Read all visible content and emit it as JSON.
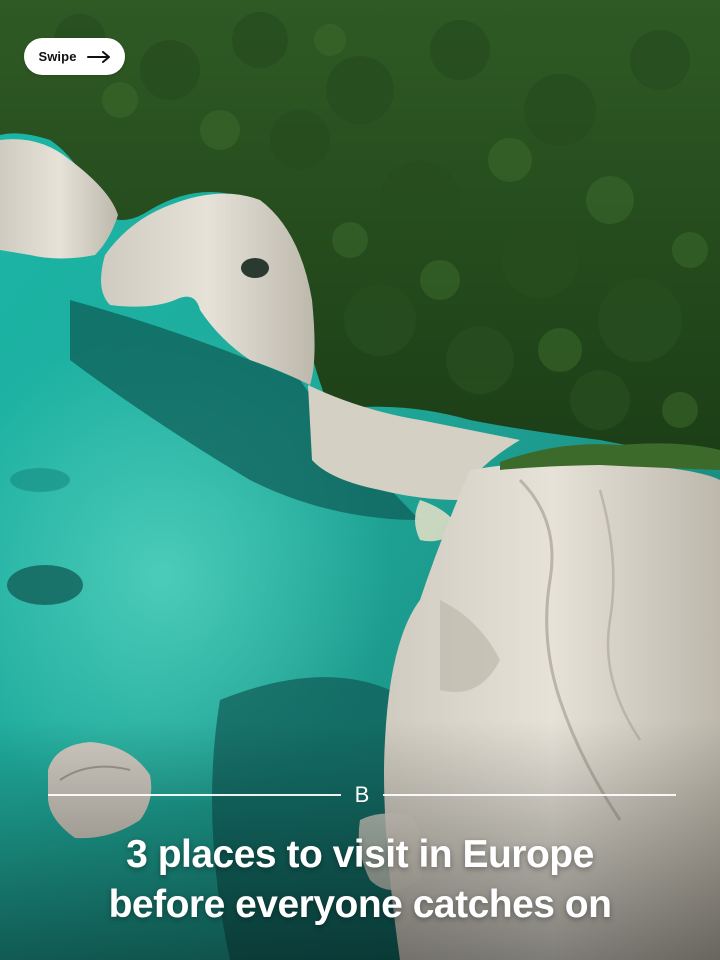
{
  "swipe": {
    "label": "Swipe",
    "icon": "arrow-right-icon"
  },
  "brand": {
    "mark": "B"
  },
  "headline": {
    "line1": "3 places to visit in Europe",
    "line2": "before everyone catches on"
  },
  "colors": {
    "forest": "#1f4a1e",
    "sea_turquoise": "#1fb3a2",
    "cliff": "#d9d6cc",
    "text": "#ffffff",
    "pill_bg": "#ffffff"
  }
}
